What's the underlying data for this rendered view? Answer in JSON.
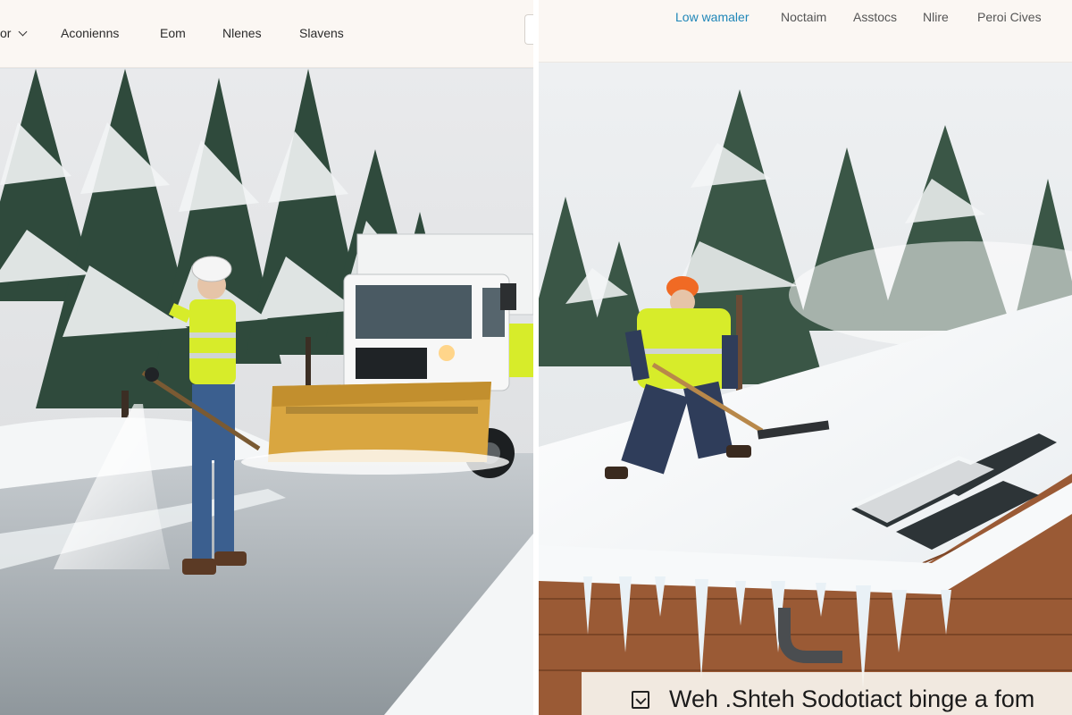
{
  "left_nav": {
    "dropdown_label": "or",
    "items": [
      "Aconienns",
      "Eom",
      "Nlenes",
      "Slavens"
    ]
  },
  "right_nav": {
    "items": [
      "Low wamaler",
      "Noctaim",
      "Asstocs",
      "Nlire",
      "Peroi Cives"
    ],
    "active_index": 0
  },
  "caption": {
    "text": "Weh .Shteh Sodotiact binge a fom"
  },
  "photos": {
    "left_alt_icon": "snow-plow-photo",
    "right_alt_icon": "roof-snow-photo"
  },
  "colors": {
    "accent": "#1f86b8",
    "hi_vis": "#d7ec2a",
    "plow_blade": "#d9a640",
    "roof_wood": "#9a5a35"
  }
}
